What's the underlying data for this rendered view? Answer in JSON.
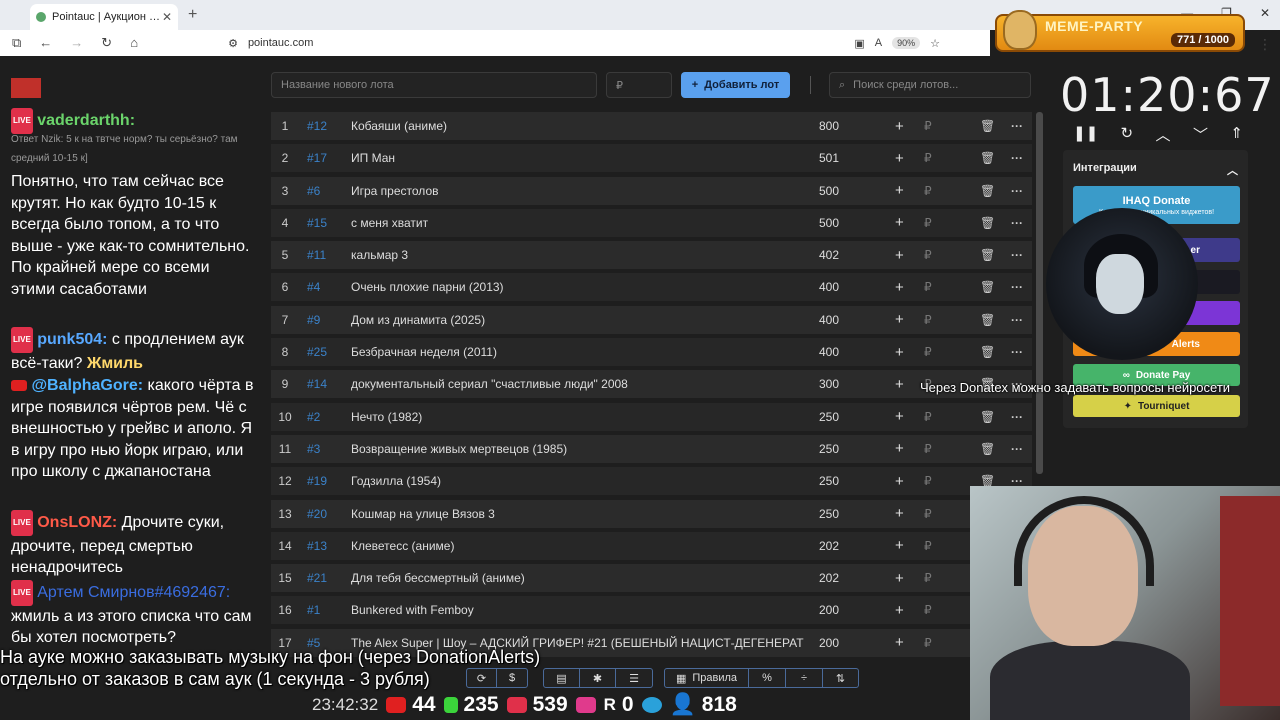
{
  "browser": {
    "tab_title": "Pointauc | Аукцион для стримеров",
    "url": "pointauc.com",
    "zoom": "90%"
  },
  "meme_party": {
    "title": "MEME-PARTY",
    "counter": "771 / 1000"
  },
  "controls": {
    "lot_placeholder": "Название нового лота",
    "price_placeholder": "₽",
    "add_label": "Добавить лот",
    "search_placeholder": "Поиск среди лотов..."
  },
  "lots": [
    {
      "num": "1",
      "id": "#12",
      "name": "Кобаяши (аниме)",
      "amount": "800"
    },
    {
      "num": "2",
      "id": "#17",
      "name": "ИП Ман",
      "amount": "501"
    },
    {
      "num": "3",
      "id": "#6",
      "name": "Игра престолов",
      "amount": "500"
    },
    {
      "num": "4",
      "id": "#15",
      "name": "с меня хватит",
      "amount": "500"
    },
    {
      "num": "5",
      "id": "#11",
      "name": "кальмар 3",
      "amount": "402"
    },
    {
      "num": "6",
      "id": "#4",
      "name": "Очень плохие парни (2013)",
      "amount": "400"
    },
    {
      "num": "7",
      "id": "#9",
      "name": "Дом из динамита (2025)",
      "amount": "400"
    },
    {
      "num": "8",
      "id": "#25",
      "name": "Безбрачная неделя (2011)",
      "amount": "400"
    },
    {
      "num": "9",
      "id": "#14",
      "name": "документальный сериал \"счастливые люди\" 2008",
      "amount": "300"
    },
    {
      "num": "10",
      "id": "#2",
      "name": "Нечто (1982)",
      "amount": "250"
    },
    {
      "num": "11",
      "id": "#3",
      "name": "Возвращение живых мертвецов (1985)",
      "amount": "250"
    },
    {
      "num": "12",
      "id": "#19",
      "name": "Годзилла (1954)",
      "amount": "250"
    },
    {
      "num": "13",
      "id": "#20",
      "name": "Кошмар на улице Вязов 3",
      "amount": "250"
    },
    {
      "num": "14",
      "id": "#13",
      "name": "Клеветесс (аниме)",
      "amount": "202"
    },
    {
      "num": "15",
      "id": "#21",
      "name": "Для тебя бессмертный (аниме)",
      "amount": "202"
    },
    {
      "num": "16",
      "id": "#1",
      "name": "Bunkered with Femboy",
      "amount": "200"
    },
    {
      "num": "17",
      "id": "#5",
      "name": "The Alex Super | Шоу – АДСКИЙ ГРИФЕР! #21 (БЕШЕНЫЙ НАЦИСТ-ДЕГЕНЕРАТ",
      "amount": "200"
    }
  ],
  "lot_currency": "₽",
  "timer": "01:20:67",
  "integrations": {
    "title": "Интеграции",
    "ihaq_label": "IHAQ Donate",
    "ihaq_sub": "Конструктор уникальных виджетов!",
    "alerts_label": "Alerts",
    "donatepay_label": "Donate Pay",
    "tourniquet_label": "Tourniquet",
    "er_label": "er"
  },
  "chat": {
    "user1": "vaderdarthh:",
    "reply": "Ответ Nzik: 5 к на твтче норм? ты серьёзно? там средний 10-15 к]",
    "msg1": "Понятно, что там сейчас все крутят. Но как будто 10-15 к всегда было топом, а то что выше - уже как-то сомнительно. По крайней мере со всеми этими сасаботами",
    "user2": "punk504:",
    "msg2a": " с продлением аук всё-таки? ",
    "msg2b": "Жмиль",
    "user3": "@BalphaGore:",
    "msg3": " какого чёрта в игре появился чёртов рем. Чё с внешностью у грейвс и аполо. Я в игру про нью йорк играю, или про школу с джапаностана",
    "user4": "OnsLONZ:",
    "msg4": " Дрочите суки, дрочите, перед смертью ненадрочитесь",
    "user5": "Артем Смирнов#4692467:",
    "msg5": " жмиль а из этого списка что сам бы хотел посмотреть?"
  },
  "toolbar": {
    "rules_label": "Правила",
    "percent_label": "%"
  },
  "overlay": {
    "line1": "На ауке можно заказывать музыку на фон (через DonationAlerts)",
    "line2": "отдельно от заказов в сам аук (1 секунда - 3 рубля)",
    "right_note": "Через Donatex можно задавать вопросы нейросети"
  },
  "stats": {
    "clock": "23:42:32",
    "youtube": "44",
    "kick": "235",
    "live": "539",
    "rutube": "0",
    "viewers": "818",
    "rutube_letter": "R"
  },
  "colors": {
    "accent": "#5aa0ee",
    "id_blue": "#3b82c9",
    "live_red": "#e0304a"
  }
}
